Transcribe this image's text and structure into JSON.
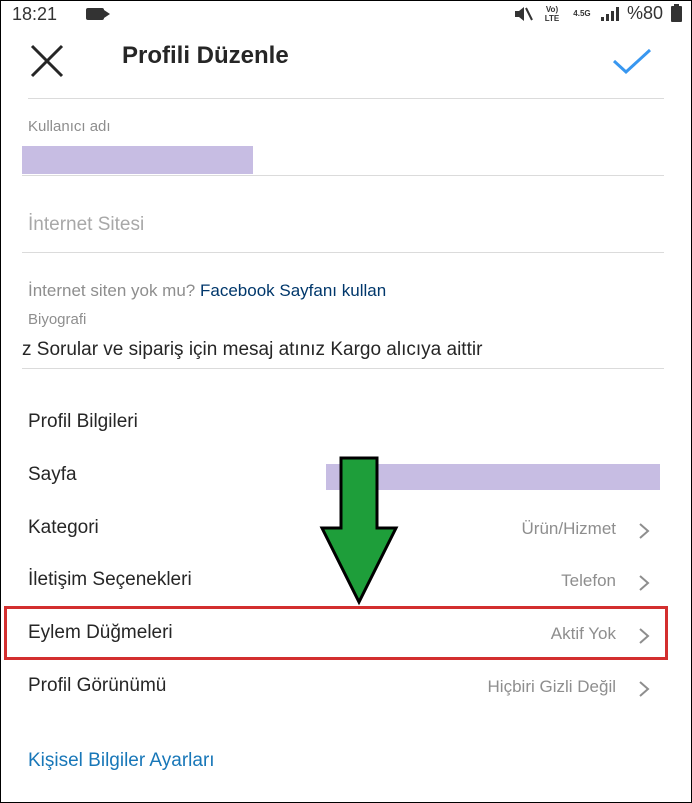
{
  "status_bar": {
    "time": "18:21",
    "battery": "%80",
    "network": "Vo) LTE",
    "network_type": "4.5G"
  },
  "header": {
    "title": "Profili Düzenle"
  },
  "form": {
    "username_label": "Kullanıcı adı",
    "website_placeholder": "İnternet Sitesi",
    "website_hint_text": "İnternet siten yok mu?",
    "website_hint_link": "Facebook Sayfanı kullan",
    "bio_label": "Biyografi",
    "bio_value": "z Sorular ve sipariş için mesaj atınız Kargo alıcıya aittir"
  },
  "profile_info": {
    "section_title": "Profil Bilgileri",
    "rows": [
      {
        "label": "Sayfa",
        "value": ""
      },
      {
        "label": "Kategori",
        "value": "Ürün/Hizmet"
      },
      {
        "label": "İletişim Seçenekleri",
        "value": "Telefon"
      },
      {
        "label": "Eylem Düğmeleri",
        "value": "Aktif Yok"
      },
      {
        "label": "Profil Görünümü",
        "value": "Hiçbiri Gizli Değil"
      }
    ]
  },
  "personal_settings_link": "Kişisel Bilgiler Ayarları",
  "colors": {
    "accent_blue": "#3897f0",
    "link_blue": "#1877b8",
    "highlight_red": "#d32f2f",
    "arrow_green": "#1e9e3a",
    "redaction": "#c7bde3"
  }
}
